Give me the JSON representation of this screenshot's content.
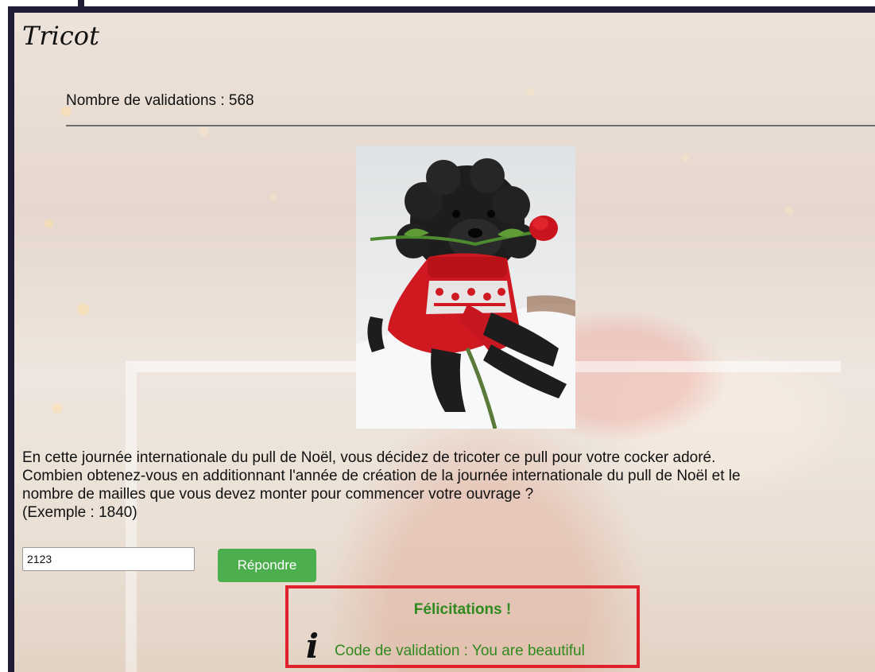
{
  "page": {
    "title": "Tricot"
  },
  "validations": {
    "label": "Nombre de validations : ",
    "count": "568"
  },
  "question": {
    "line1": "En cette journée internationale du pull de Noël, vous décidez de tricoter ce pull pour votre cocker adoré.",
    "line2": "Combien obtenez-vous en additionnant l'année de création de la journée internationale du pull de Noël et le",
    "line3": "nombre de mailles que vous devez monter pour commencer votre ouvrage ?",
    "example": "(Exemple : 1840)"
  },
  "answer": {
    "value": "2123"
  },
  "submit": {
    "label": "Répondre"
  },
  "result": {
    "title": "Félicitations !",
    "icon": "info-icon",
    "prefix": "Code de validation : ",
    "code": "You are beautiful"
  },
  "colors": {
    "frame": "#1f1d36",
    "button": "#4cae4c",
    "success_text": "#2f8a1f",
    "result_border": "#e0202b"
  }
}
